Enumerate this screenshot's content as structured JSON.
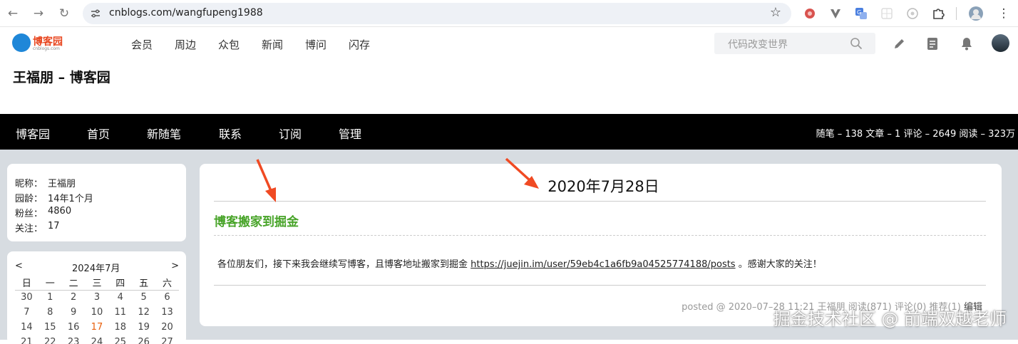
{
  "browser": {
    "url": "cnblogs.com/wangfupeng1988",
    "back_icon": "arrow-left-icon",
    "forward_icon": "arrow-right-icon",
    "reload_icon": "reload-icon",
    "bookmark_icon": "star-icon"
  },
  "site": {
    "logo_text": "博客园",
    "logo_sub": "cnblogs.com",
    "nav": [
      "会员",
      "周边",
      "众包",
      "新闻",
      "博问",
      "闪存"
    ],
    "search_placeholder": "代码改变世界"
  },
  "blog": {
    "title": "王福朋 – 博客园",
    "menu": [
      "博客园",
      "首页",
      "新随笔",
      "联系",
      "订阅",
      "管理"
    ],
    "stats": "随笔 – 138  文章 – 1  评论 – 2649  阅读 – 323万"
  },
  "profile": {
    "rows": [
      {
        "label": "昵称：",
        "value": "王福朋"
      },
      {
        "label": "园龄：",
        "value": "14年1个月"
      },
      {
        "label": "粉丝：",
        "value": "4860"
      },
      {
        "label": "关注：",
        "value": "17"
      }
    ]
  },
  "calendar": {
    "prev": "<",
    "month": "2024年7月",
    "next": ">",
    "weekdays": [
      "日",
      "一",
      "二",
      "三",
      "四",
      "五",
      "六"
    ],
    "weeks": [
      [
        "30",
        "1",
        "2",
        "3",
        "4",
        "5",
        "6"
      ],
      [
        "7",
        "8",
        "9",
        "10",
        "11",
        "12",
        "13"
      ],
      [
        "14",
        "15",
        "16",
        "17",
        "18",
        "19",
        "20"
      ],
      [
        "21",
        "22",
        "23",
        "24",
        "25",
        "26",
        "27"
      ]
    ],
    "today": "17"
  },
  "post": {
    "date": "2020年7月28日",
    "title": "博客搬家到掘金",
    "body_prefix": "各位朋友们，接下来我会继续写博客，且博客地址搬家到掘金",
    "link": "https://juejin.im/user/59eb4c1a6fb9a04525774188/posts",
    "body_suffix": "。感谢大家的关注！",
    "footer": "posted @ 2020–07–28 11:21 王福朋 阅读(871) 评论(0) 推荐(1)",
    "edit": "编辑"
  },
  "watermark": "掘金技术社区 @ 前端双越老师",
  "colors": {
    "post_title": "#48a429",
    "arrow": "#f04a23",
    "menu_bar": "#000000",
    "page_bg": "#d7dce1"
  }
}
